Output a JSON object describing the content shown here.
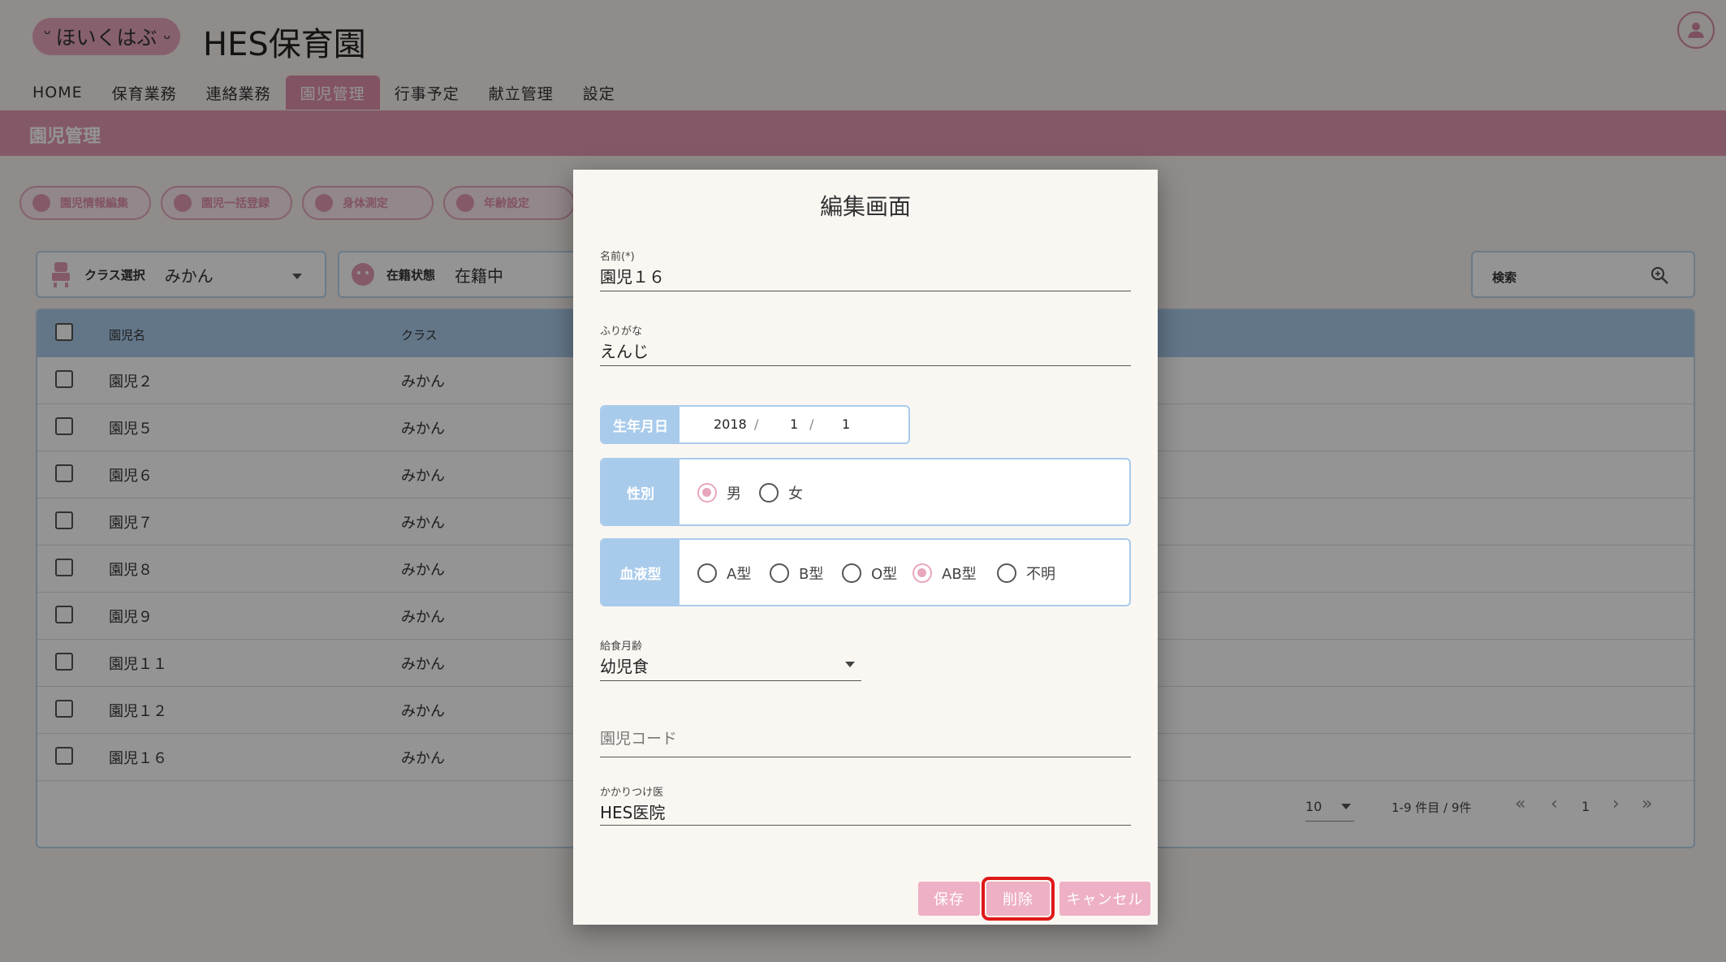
{
  "header": {
    "logo_text": "ほいくはぶ",
    "app_title": "HES保育園",
    "nav": [
      "HOME",
      "保育業務",
      "連絡業務",
      "園児管理",
      "行事予定",
      "献立管理",
      "設定"
    ],
    "active_nav": "園児管理"
  },
  "page": {
    "title": "園児管理",
    "actions": [
      "園児情報編集",
      "園児一括登録",
      "身体測定",
      "年齢設定"
    ]
  },
  "filters": {
    "class_label": "クラス選択",
    "class_value": "みかん",
    "status_label": "在籍状態",
    "status_value": "在籍中",
    "search_label": "検索"
  },
  "table": {
    "headers": [
      "園児名",
      "クラス"
    ],
    "rows": [
      {
        "name": "園児２",
        "class": "みかん"
      },
      {
        "name": "園児５",
        "class": "みかん"
      },
      {
        "name": "園児６",
        "class": "みかん"
      },
      {
        "name": "園児７",
        "class": "みかん"
      },
      {
        "name": "園児８",
        "class": "みかん"
      },
      {
        "name": "園児９",
        "class": "みかん"
      },
      {
        "name": "園児１１",
        "class": "みかん"
      },
      {
        "name": "園児１２",
        "class": "みかん"
      },
      {
        "name": "園児１６",
        "class": "みかん"
      }
    ],
    "per_page": "10",
    "range_text": "1-9 件目 / 9件",
    "page": "1"
  },
  "dialog": {
    "title": "編集画面",
    "name_label": "名前(*)",
    "name_value": "園児１６",
    "kana_label": "ふりがな",
    "kana_value": "えんじ",
    "birth_label": "生年月日",
    "birth_year": "2018",
    "birth_month": "1",
    "birth_day": "1",
    "gender_label": "性別",
    "gender_options": [
      "男",
      "女"
    ],
    "gender_selected": "男",
    "blood_label": "血液型",
    "blood_options": [
      "A型",
      "B型",
      "O型",
      "AB型",
      "不明"
    ],
    "blood_selected": "AB型",
    "meal_label": "給食月齢",
    "meal_value": "幼児食",
    "code_placeholder": "園児コード",
    "doctor_label": "かかりつけ医",
    "doctor_value": "HES医院",
    "buttons": {
      "save": "保存",
      "delete": "削除",
      "cancel": "キャンセル"
    }
  },
  "colors": {
    "accent_pink": "#e08fab",
    "header_blue": "#a9cbeb",
    "highlight_red": "#e01818"
  }
}
